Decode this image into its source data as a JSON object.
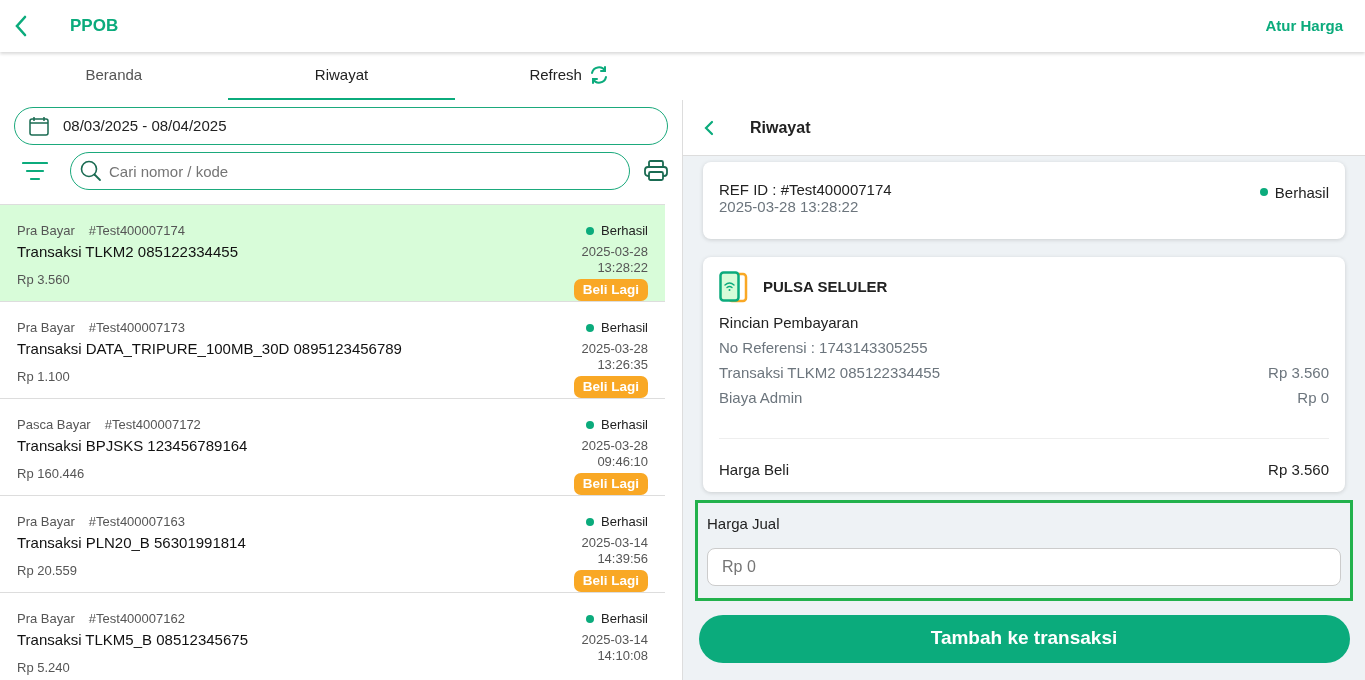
{
  "header": {
    "title": "PPOB",
    "action": "Atur Harga"
  },
  "tabs": [
    {
      "label": "Beranda",
      "kind": "tab",
      "selected": false
    },
    {
      "label": "Riwayat",
      "kind": "tab",
      "selected": true
    },
    {
      "label": "Refresh",
      "kind": "refresh",
      "selected": false
    }
  ],
  "filters": {
    "date_range": "08/03/2025 - 08/04/2025",
    "search_placeholder": "Cari nomor / kode"
  },
  "transactions": [
    {
      "type": "Pra Bayar",
      "ref": "#Test400007174",
      "title": "Transaksi TLKM2 085122334455",
      "amount": "Rp 3.560",
      "status": "Berhasil",
      "date": "2025-03-28",
      "time": "13:28:22",
      "action": "Beli Lagi",
      "selected": true
    },
    {
      "type": "Pra Bayar",
      "ref": "#Test400007173",
      "title": "Transaksi DATA_TRIPURE_100MB_30D 0895123456789",
      "amount": "Rp 1.100",
      "status": "Berhasil",
      "date": "2025-03-28",
      "time": "13:26:35",
      "action": "Beli Lagi",
      "selected": false
    },
    {
      "type": "Pasca Bayar",
      "ref": "#Test400007172",
      "title": "Transaksi BPJSKS 123456789164",
      "amount": "Rp 160.446",
      "status": "Berhasil",
      "date": "2025-03-28",
      "time": "09:46:10",
      "action": "Beli Lagi",
      "selected": false
    },
    {
      "type": "Pra Bayar",
      "ref": "#Test400007163",
      "title": "Transaksi PLN20_B 56301991814",
      "amount": "Rp 20.559",
      "status": "Berhasil",
      "date": "2025-03-14",
      "time": "14:39:56",
      "action": "Beli Lagi",
      "selected": false
    },
    {
      "type": "Pra Bayar",
      "ref": "#Test400007162",
      "title": "Transaksi TLKM5_B 08512345675",
      "amount": "Rp 5.240",
      "status": "Berhasil",
      "date": "2025-03-14",
      "time": "14:10:08",
      "selected": false
    }
  ],
  "detail": {
    "title": "Riwayat",
    "ref_id": "REF ID : #Test400007174",
    "datetime": "2025-03-28 13:28:22",
    "status": "Berhasil",
    "category": "PULSA SELULER",
    "section_title": "Rincian Pembayaran",
    "reference": "No Referensi : 1743143305255",
    "lines": [
      {
        "label": "Transaksi TLKM2 085122334455",
        "value": "Rp 3.560"
      },
      {
        "label": "Biaya Admin",
        "value": "Rp 0"
      }
    ],
    "total": {
      "label": "Harga Beli",
      "value": "Rp 3.560"
    }
  },
  "sell": {
    "label": "Harga Jual",
    "placeholder": "Rp 0"
  },
  "submit": "Tambah ke transaksi"
}
